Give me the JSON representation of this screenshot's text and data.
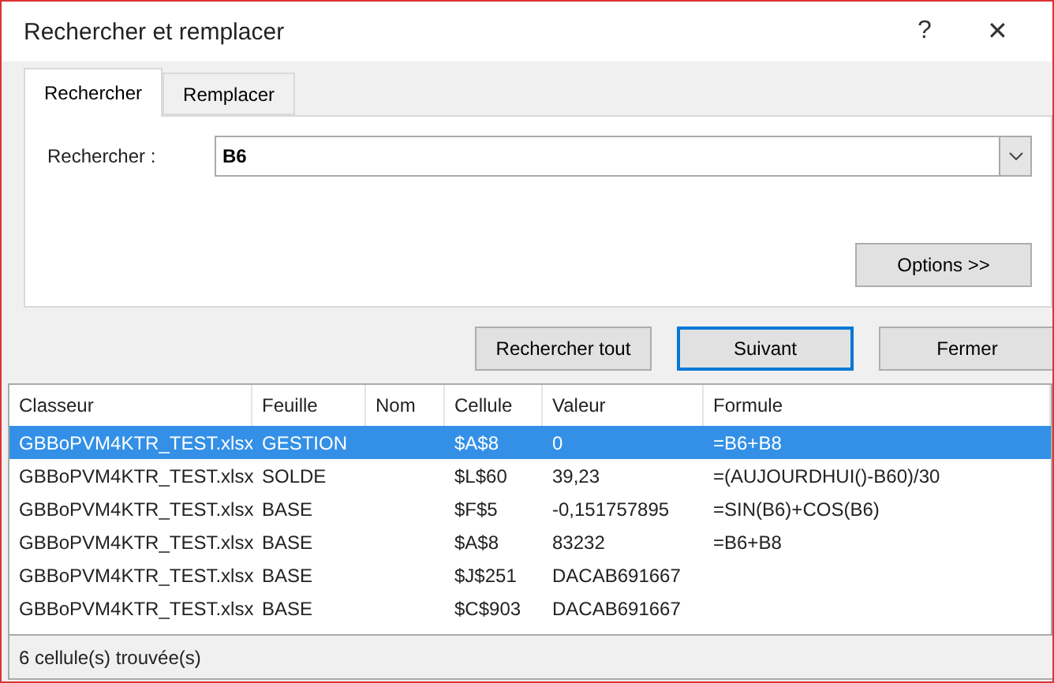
{
  "window": {
    "title": "Rechercher et remplacer",
    "help": "?",
    "close": "✕"
  },
  "tabs": [
    {
      "label": "Rechercher",
      "selected": true
    },
    {
      "label": "Remplacer",
      "selected": false
    }
  ],
  "search": {
    "label": "Rechercher :",
    "value": "B6"
  },
  "options_button": "Options >>",
  "buttons": [
    {
      "label": "Rechercher tout",
      "selected": false
    },
    {
      "label": "Suivant",
      "selected": true
    },
    {
      "label": "Fermer",
      "selected": false
    }
  ],
  "table": {
    "columns": [
      "Classeur",
      "Feuille",
      "Nom",
      "Cellule",
      "Valeur",
      "Formule"
    ],
    "rows": [
      {
        "selected": true,
        "cells": [
          "GBBoPVM4KTR_TEST.xlsx",
          "GESTION",
          "",
          "$A$8",
          "0",
          "=B6+B8"
        ]
      },
      {
        "selected": false,
        "cells": [
          "GBBoPVM4KTR_TEST.xlsx",
          "SOLDE",
          "",
          "$L$60",
          "39,23",
          "=(AUJOURDHUI()-B60)/30"
        ]
      },
      {
        "selected": false,
        "cells": [
          "GBBoPVM4KTR_TEST.xlsx",
          "BASE",
          "",
          "$F$5",
          "-0,151757895",
          "=SIN(B6)+COS(B6)"
        ]
      },
      {
        "selected": false,
        "cells": [
          "GBBoPVM4KTR_TEST.xlsx",
          "BASE",
          "",
          "$A$8",
          "83232",
          "=B6+B8"
        ]
      },
      {
        "selected": false,
        "cells": [
          "GBBoPVM4KTR_TEST.xlsx",
          "BASE",
          "",
          "$J$251",
          "DACAB691667",
          ""
        ]
      },
      {
        "selected": false,
        "cells": [
          "GBBoPVM4KTR_TEST.xlsx",
          "BASE",
          "",
          "$C$903",
          "DACAB691667",
          ""
        ]
      }
    ]
  },
  "status_bar": "6 cellule(s) trouvée(s)"
}
